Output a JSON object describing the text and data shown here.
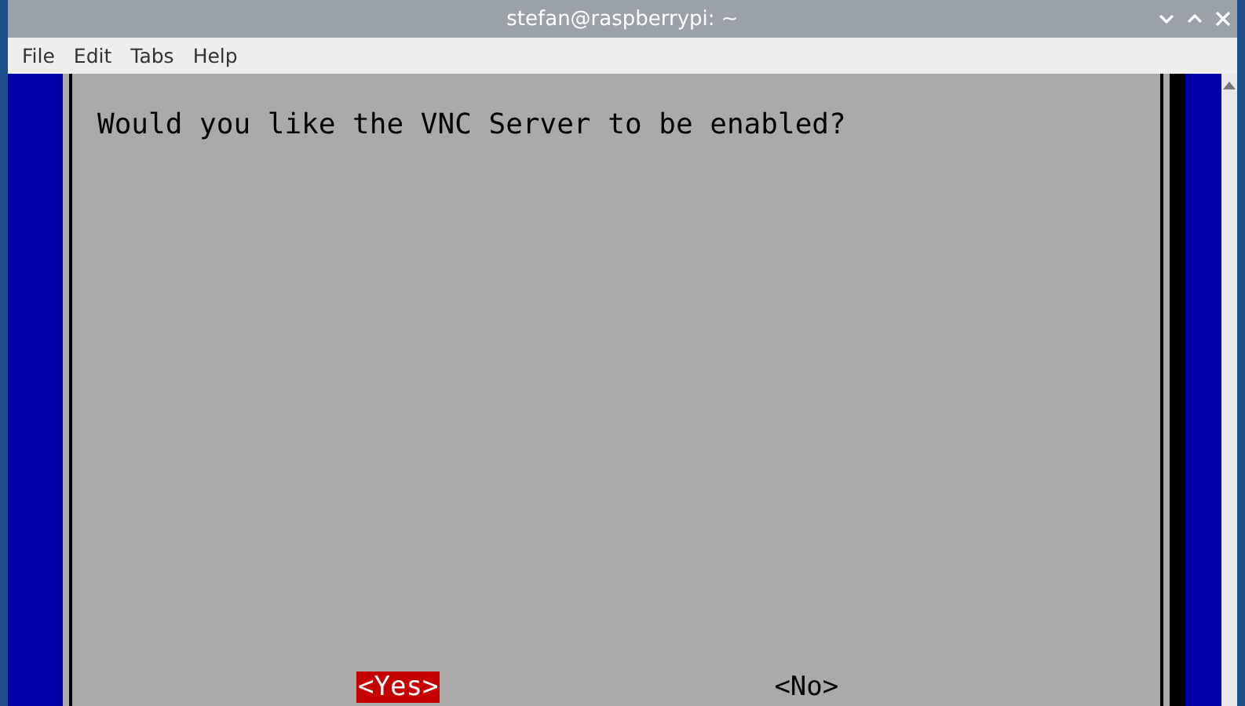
{
  "window": {
    "title": "stefan@raspberrypi: ~"
  },
  "menu": [
    "File",
    "Edit",
    "Tabs",
    "Help"
  ],
  "dialog": {
    "message": "Would you like the VNC Server to be enabled?",
    "buttons": [
      {
        "label": "<Yes>",
        "selected": true
      },
      {
        "label": "<No>",
        "selected": false
      }
    ]
  }
}
